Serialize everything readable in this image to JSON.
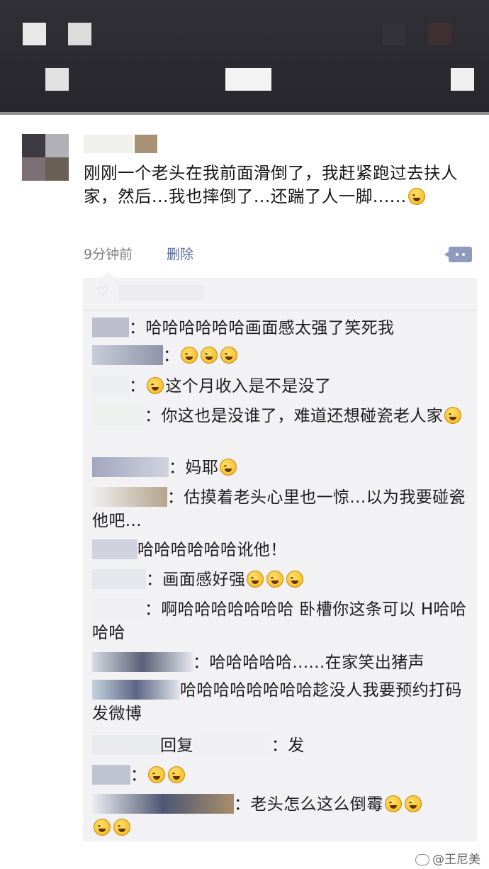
{
  "post": {
    "text": "刚刚一个老头在我前面滑倒了，我赶紧跑过去扶人家，然后...我也摔倒了...还踹了人一脚......",
    "time": "9分钟前",
    "delete_label": "删除"
  },
  "comments": [
    {
      "text": "：哈哈哈哈哈哈画面感太强了笑死我",
      "emoji_count": 0
    },
    {
      "text": "：",
      "emoji_count": 3
    },
    {
      "text": "这个月收入是不是没了",
      "emoji_before": 1
    },
    {
      "text": "：你这也是没谁了，难道还想碰瓷老人家",
      "emoji_count": 1
    },
    {
      "text": "：妈耶",
      "emoji_count": 1
    },
    {
      "text": "：估摸着老头心里也一惊...以为我要碰瓷他吧...",
      "emoji_count": 0
    },
    {
      "text": "哈哈哈哈哈哈讹他！",
      "emoji_count": 0
    },
    {
      "text": "：画面感好强",
      "emoji_count": 3
    },
    {
      "text": "：啊哈哈哈哈哈哈哈 卧槽你这条可以 H哈哈哈哈",
      "emoji_count": 0
    },
    {
      "text": "：哈哈哈哈哈......在家笑出猪声",
      "emoji_count": 0
    },
    {
      "text": "哈哈哈哈哈哈哈哈趁没人我要预约打码发微博",
      "emoji_count": 0
    },
    {
      "reply_label": "回复",
      "text": "：发",
      "emoji_count": 0
    },
    {
      "text": "：",
      "emoji_count": 2
    },
    {
      "text": "：老头怎么这么倒霉",
      "emoji_count": 4
    }
  ],
  "watermark": "王尼美",
  "colors": {
    "link": "#5b6b95",
    "panel": "#f2f2f4",
    "topbar": "#2b2b30"
  }
}
